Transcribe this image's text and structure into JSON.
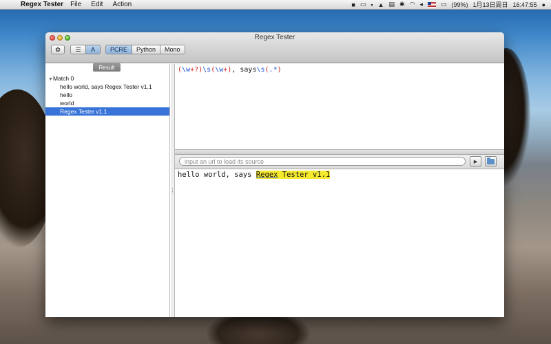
{
  "menubar": {
    "app_name": "Regex Tester",
    "menus": [
      "File",
      "Edit",
      "Action"
    ],
    "battery": "(99%)",
    "date": "1月13日周日",
    "time": "16:47:55"
  },
  "window": {
    "title": "Regex Tester",
    "engines": [
      "PCRE",
      "Python",
      "Mono"
    ],
    "selected_engine": "PCRE"
  },
  "result_panel": {
    "tab_label": "Result",
    "tree": {
      "root": "Match 0",
      "children": [
        "hello world, says Regex Tester v1.1",
        "hello",
        "world",
        "Regex Tester v1.1"
      ],
      "selected": "Regex Tester v1.1"
    }
  },
  "regex": {
    "tokens": [
      {
        "text": "(",
        "kind": "red"
      },
      {
        "text": "\\w",
        "kind": "blue"
      },
      {
        "text": "+?",
        "kind": "red"
      },
      {
        "text": ")",
        "kind": "red"
      },
      {
        "text": "\\s",
        "kind": "blue"
      },
      {
        "text": "(",
        "kind": "red"
      },
      {
        "text": "\\w",
        "kind": "blue"
      },
      {
        "text": "+",
        "kind": "red"
      },
      {
        "text": ")",
        "kind": "red"
      },
      {
        "text": ", says",
        "kind": "plain"
      },
      {
        "text": "\\s",
        "kind": "blue"
      },
      {
        "text": "(",
        "kind": "red"
      },
      {
        "text": ".*",
        "kind": "blue"
      },
      {
        "text": ")",
        "kind": "red"
      }
    ]
  },
  "url_bar": {
    "placeholder": "input an url to load its source"
  },
  "test_text": {
    "before": "hello world, says ",
    "highlight_part1": "Regex",
    "highlight_part2": " Tester v1.1"
  },
  "colors": {
    "regex_group": "#d21a1a",
    "regex_escape": "#1c4fd8",
    "highlight": "#f6ea2f",
    "selection": "#3874d8"
  }
}
